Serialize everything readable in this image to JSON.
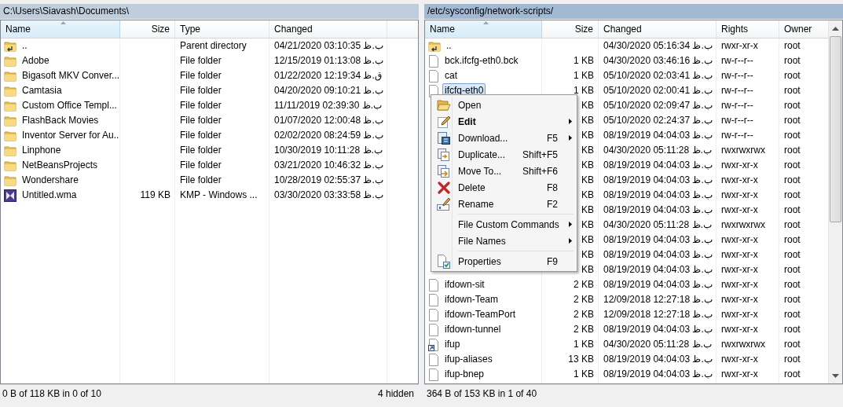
{
  "left_panel": {
    "path": "C:\\Users\\Siavash\\Documents\\",
    "columns": [
      {
        "label": "Name",
        "sorted": true
      },
      {
        "label": "Size",
        "sorted": false
      },
      {
        "label": "Type",
        "sorted": false
      },
      {
        "label": "Changed",
        "sorted": false
      }
    ],
    "rows": [
      {
        "kind": "parent",
        "selected": false,
        "cells": [
          "..",
          null,
          "Parent directory",
          "04/21/2020  03:10:35 ب.ظ"
        ]
      },
      {
        "kind": "folder",
        "selected": false,
        "cells": [
          "Adobe",
          null,
          "File folder",
          "12/15/2019  01:13:08 ب.ظ"
        ]
      },
      {
        "kind": "folder",
        "selected": false,
        "cells": [
          "Bigasoft MKV Conver...",
          null,
          "File folder",
          "01/22/2020  12:19:34 ق.ظ"
        ]
      },
      {
        "kind": "folder",
        "selected": false,
        "cells": [
          "Camtasia",
          null,
          "File folder",
          "04/20/2020  09:10:21 ب.ظ"
        ]
      },
      {
        "kind": "folder",
        "selected": false,
        "cells": [
          "Custom Office Templ...",
          null,
          "File folder",
          "11/11/2019  02:39:30 ب.ظ"
        ]
      },
      {
        "kind": "folder",
        "selected": false,
        "cells": [
          "FlashBack Movies",
          null,
          "File folder",
          "01/07/2020  12:00:48 ب.ظ"
        ]
      },
      {
        "kind": "folder",
        "selected": false,
        "cells": [
          "Inventor Server for Au...",
          null,
          "File folder",
          "02/02/2020  08:24:59 ب.ظ"
        ]
      },
      {
        "kind": "folder",
        "selected": false,
        "cells": [
          "Linphone",
          null,
          "File folder",
          "10/30/2019  10:11:28 ب.ظ"
        ]
      },
      {
        "kind": "folder",
        "selected": false,
        "cells": [
          "NetBeansProjects",
          null,
          "File folder",
          "03/21/2020  10:46:32 ب.ظ"
        ]
      },
      {
        "kind": "folder",
        "selected": false,
        "cells": [
          "Wondershare",
          null,
          "File folder",
          "10/28/2019  02:55:37 ب.ظ"
        ]
      },
      {
        "kind": "media",
        "selected": false,
        "cells": [
          "Untitled.wma",
          "119 KB",
          "KMP - Windows ...",
          "03/30/2020  03:33:58 ب.ظ"
        ]
      }
    ],
    "status": "0 B of 118 KB in 0 of 10",
    "hidden_count": "4 hidden"
  },
  "right_panel": {
    "path": "/etc/sysconfig/network-scripts/",
    "columns": [
      {
        "label": "Name",
        "sorted": true
      },
      {
        "label": "Size",
        "sorted": false
      },
      {
        "label": "Changed",
        "sorted": false
      },
      {
        "label": "Rights",
        "sorted": false
      },
      {
        "label": "Owner",
        "sorted": false
      }
    ],
    "rows": [
      {
        "kind": "parent",
        "selected": false,
        "cells": [
          "..",
          null,
          "04/30/2020 05:16:34 ب.ظ",
          "rwxr-xr-x",
          "root"
        ]
      },
      {
        "kind": "file",
        "selected": false,
        "cells": [
          "bck.ifcfg-eth0.bck",
          "1 KB",
          "04/30/2020 03:46:16 ب.ظ",
          "rw-r--r--",
          "root"
        ]
      },
      {
        "kind": "file",
        "selected": false,
        "cells": [
          "cat",
          "1 KB",
          "05/10/2020 02:03:41 ب.ظ",
          "rw-r--r--",
          "root"
        ]
      },
      {
        "kind": "file",
        "selected": true,
        "cells": [
          "ifcfg-eth0",
          "1 KB",
          "05/10/2020 02:00:41 ب.ظ",
          "rw-r--r--",
          "root"
        ]
      },
      {
        "cells": [
          null,
          "KB",
          "05/10/2020 02:09:47 ب.ظ",
          "rw-r--r--",
          "root"
        ]
      },
      {
        "cells": [
          null,
          "KB",
          "05/10/2020 02:24:37 ب.ظ",
          "rw-r--r--",
          "root"
        ]
      },
      {
        "cells": [
          null,
          "KB",
          "08/19/2019 04:04:03 ب.ظ",
          "rw-r--r--",
          "root"
        ]
      },
      {
        "cells": [
          null,
          "KB",
          "04/30/2020 05:11:28 ب.ظ",
          "rwxrwxrwx",
          "root"
        ]
      },
      {
        "cells": [
          null,
          "KB",
          "08/19/2019 04:04:03 ب.ظ",
          "rwxr-xr-x",
          "root"
        ]
      },
      {
        "cells": [
          null,
          "KB",
          "08/19/2019 04:04:03 ب.ظ",
          "rwxr-xr-x",
          "root"
        ]
      },
      {
        "cells": [
          null,
          "KB",
          "08/19/2019 04:04:03 ب.ظ",
          "rwxr-xr-x",
          "root"
        ]
      },
      {
        "cells": [
          null,
          "KB",
          "08/19/2019 04:04:03 ب.ظ",
          "rwxr-xr-x",
          "root"
        ]
      },
      {
        "cells": [
          null,
          "KB",
          "04/30/2020 05:11:28 ب.ظ",
          "rwxrwxrwx",
          "root"
        ]
      },
      {
        "cells": [
          null,
          "KB",
          "08/19/2019 04:04:03 ب.ظ",
          "rwxr-xr-x",
          "root"
        ]
      },
      {
        "cells": [
          null,
          "KB",
          "08/19/2019 04:04:03 ب.ظ",
          "rwxr-xr-x",
          "root"
        ]
      },
      {
        "cells": [
          null,
          "KB",
          "08/19/2019 04:04:03 ب.ظ",
          "rwxr-xr-x",
          "root"
        ]
      },
      {
        "kind": "file",
        "selected": false,
        "cells": [
          "ifdown-sit",
          "2 KB",
          "08/19/2019 04:04:03 ب.ظ",
          "rwxr-xr-x",
          "root"
        ]
      },
      {
        "kind": "file",
        "selected": false,
        "cells": [
          "ifdown-Team",
          "2 KB",
          "12/09/2018 12:27:18 ب.ظ",
          "rwxr-xr-x",
          "root"
        ]
      },
      {
        "kind": "file",
        "selected": false,
        "cells": [
          "ifdown-TeamPort",
          "2 KB",
          "12/09/2018 12:27:18 ب.ظ",
          "rwxr-xr-x",
          "root"
        ]
      },
      {
        "kind": "file",
        "selected": false,
        "cells": [
          "ifdown-tunnel",
          "2 KB",
          "08/19/2019 04:04:03 ب.ظ",
          "rwxr-xr-x",
          "root"
        ]
      },
      {
        "kind": "link",
        "selected": false,
        "cells": [
          "ifup",
          "1 KB",
          "04/30/2020 05:11:28 ب.ظ",
          "rwxrwxrwx",
          "root"
        ]
      },
      {
        "kind": "file",
        "selected": false,
        "cells": [
          "ifup-aliases",
          "13 KB",
          "08/19/2019 04:04:03 ب.ظ",
          "rwxr-xr-x",
          "root"
        ]
      },
      {
        "kind": "file",
        "selected": false,
        "cells": [
          "ifup-bnep",
          "1 KB",
          "08/19/2019 04:04:03 ب.ظ",
          "rwxr-xr-x",
          "root"
        ]
      }
    ],
    "status": "364 B of 153 KB in 1 of 40"
  },
  "context_menu": {
    "items": [
      {
        "kind": "item",
        "label": "Open",
        "bold": false,
        "submenu": false
      },
      {
        "kind": "item",
        "label": "Edit",
        "bold": true,
        "submenu": true
      },
      {
        "kind": "item",
        "label": "Download...",
        "shortcut": "F5",
        "bold": false,
        "submenu": true
      },
      {
        "kind": "item",
        "label": "Duplicate...",
        "shortcut": "Shift+F5",
        "bold": false,
        "submenu": false
      },
      {
        "kind": "item",
        "label": "Move To...",
        "shortcut": "Shift+F6",
        "bold": false,
        "submenu": false
      },
      {
        "kind": "item",
        "label": "Delete",
        "shortcut": "F8",
        "bold": false,
        "submenu": false
      },
      {
        "kind": "item",
        "label": "Rename",
        "shortcut": "F2",
        "bold": false,
        "submenu": false
      },
      {
        "kind": "separator"
      },
      {
        "kind": "item",
        "label": "File Custom Commands",
        "bold": false,
        "submenu": true
      },
      {
        "kind": "item",
        "label": "File Names",
        "bold": false,
        "submenu": true
      },
      {
        "kind": "separator"
      },
      {
        "kind": "item",
        "label": "Properties",
        "shortcut": "F9",
        "bold": false,
        "submenu": false
      }
    ]
  }
}
